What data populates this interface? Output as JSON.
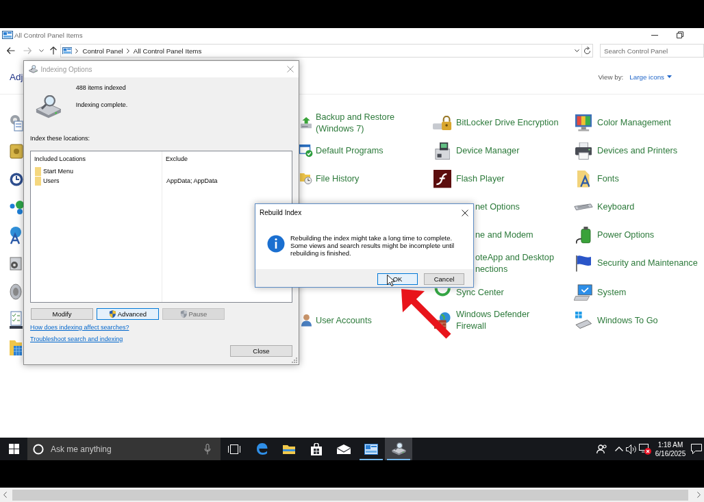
{
  "window": {
    "title": "All Control Panel Items"
  },
  "address_bar": {
    "path": [
      "Control Panel",
      "All Control Panel Items"
    ]
  },
  "search": {
    "placeholder": "Search Control Panel"
  },
  "heading": "Adj",
  "view_by": {
    "label": "View by:",
    "value": "Large icons"
  },
  "rows": [
    {
      "items": [
        {
          "kind": "item",
          "label": "Backup and Restore (Windows 7)"
        },
        {
          "kind": "item",
          "label": "BitLocker Drive Encryption"
        },
        {
          "kind": "item",
          "label": "Color Management"
        }
      ]
    },
    {
      "items": [
        {
          "kind": "item",
          "label": "Default Programs"
        },
        {
          "kind": "item",
          "label": "Device Manager"
        },
        {
          "kind": "item",
          "label": "Devices and Printers"
        }
      ]
    },
    {
      "items": [
        {
          "kind": "item",
          "label": "File History"
        },
        {
          "kind": "item",
          "label": "Flash Player"
        },
        {
          "kind": "item",
          "label": "Fonts"
        }
      ]
    },
    {
      "items": [
        {
          "kind": "covered",
          "label": "net Options"
        },
        {
          "kind": "item",
          "label": "Keyboard"
        }
      ]
    },
    {
      "items": [
        {
          "kind": "covered",
          "label": "ne and Modem"
        },
        {
          "kind": "item",
          "label": "Power Options"
        }
      ]
    },
    {
      "items": [
        {
          "kind": "covered",
          "label": "oteApp and Desktop nections"
        },
        {
          "kind": "item",
          "label": "Security and Maintenance"
        }
      ]
    },
    {
      "items": [
        {
          "kind": "item",
          "label": "Sync Center"
        },
        {
          "kind": "item",
          "label": "System"
        }
      ]
    },
    {
      "items": [
        {
          "kind": "item",
          "label": "User Accounts"
        },
        {
          "kind": "item",
          "label": "Windows Defender Firewall"
        },
        {
          "kind": "item",
          "label": "Windows To Go"
        }
      ]
    }
  ],
  "indexing_dialog": {
    "title": "Indexing Options",
    "active": false,
    "count": "488 items indexed",
    "status": "Indexing complete.",
    "locations_label": "Index these locations:",
    "columns": [
      "Included Locations",
      "Exclude"
    ],
    "locations": [
      {
        "name": "Start Menu"
      },
      {
        "name": "Users",
        "exclude": "AppData; AppData"
      }
    ],
    "buttons": [
      {
        "label": "Modify",
        "shield": false,
        "focused": false,
        "disabled": false
      },
      {
        "label": "Advanced",
        "shield": true,
        "focused": true,
        "disabled": false
      },
      {
        "label": "Pause",
        "shield": true,
        "focused": false,
        "disabled": true
      }
    ],
    "links": [
      "How does indexing affect searches?",
      "Troubleshoot search and indexing"
    ],
    "close_button": "Close"
  },
  "rebuild_dialog": {
    "title": "Rebuild Index",
    "active": true,
    "message": "Rebuilding the index might take a long time to complete. Some views and search results might be incomplete until rebuilding is finished.",
    "buttons": [
      {
        "label": "OK",
        "focused": true
      },
      {
        "label": "Cancel",
        "focused": false
      }
    ]
  },
  "taskbar": {
    "search": {
      "placeholder": "Ask me anything"
    },
    "apps": [
      {
        "kind": "browser",
        "open": false,
        "selected": false
      },
      {
        "kind": "files",
        "open": false,
        "selected": false
      },
      {
        "kind": "store",
        "open": false,
        "selected": false
      },
      {
        "kind": "mail",
        "open": false,
        "selected": false
      },
      {
        "kind": "panel",
        "open": true,
        "selected": false
      },
      {
        "kind": "indexer",
        "open": true,
        "selected": true
      }
    ],
    "clock": {
      "time": "1:18 AM",
      "date": "6/16/2025"
    }
  }
}
